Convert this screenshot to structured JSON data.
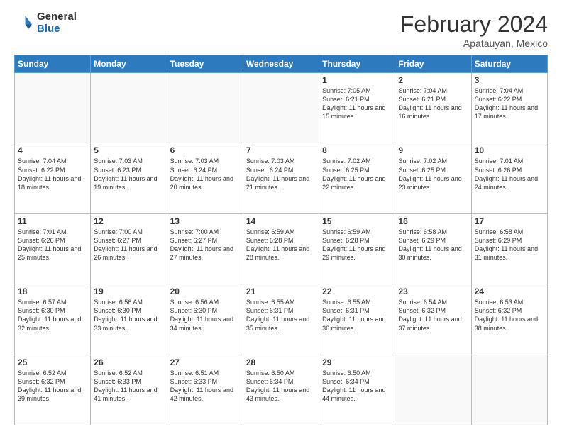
{
  "header": {
    "logo_general": "General",
    "logo_blue": "Blue",
    "month_title": "February 2024",
    "location": "Apatauyan, Mexico"
  },
  "weekdays": [
    "Sunday",
    "Monday",
    "Tuesday",
    "Wednesday",
    "Thursday",
    "Friday",
    "Saturday"
  ],
  "weeks": [
    [
      {
        "day": "",
        "info": ""
      },
      {
        "day": "",
        "info": ""
      },
      {
        "day": "",
        "info": ""
      },
      {
        "day": "",
        "info": ""
      },
      {
        "day": "1",
        "info": "Sunrise: 7:05 AM\nSunset: 6:21 PM\nDaylight: 11 hours and 15 minutes."
      },
      {
        "day": "2",
        "info": "Sunrise: 7:04 AM\nSunset: 6:21 PM\nDaylight: 11 hours and 16 minutes."
      },
      {
        "day": "3",
        "info": "Sunrise: 7:04 AM\nSunset: 6:22 PM\nDaylight: 11 hours and 17 minutes."
      }
    ],
    [
      {
        "day": "4",
        "info": "Sunrise: 7:04 AM\nSunset: 6:22 PM\nDaylight: 11 hours and 18 minutes."
      },
      {
        "day": "5",
        "info": "Sunrise: 7:03 AM\nSunset: 6:23 PM\nDaylight: 11 hours and 19 minutes."
      },
      {
        "day": "6",
        "info": "Sunrise: 7:03 AM\nSunset: 6:24 PM\nDaylight: 11 hours and 20 minutes."
      },
      {
        "day": "7",
        "info": "Sunrise: 7:03 AM\nSunset: 6:24 PM\nDaylight: 11 hours and 21 minutes."
      },
      {
        "day": "8",
        "info": "Sunrise: 7:02 AM\nSunset: 6:25 PM\nDaylight: 11 hours and 22 minutes."
      },
      {
        "day": "9",
        "info": "Sunrise: 7:02 AM\nSunset: 6:25 PM\nDaylight: 11 hours and 23 minutes."
      },
      {
        "day": "10",
        "info": "Sunrise: 7:01 AM\nSunset: 6:26 PM\nDaylight: 11 hours and 24 minutes."
      }
    ],
    [
      {
        "day": "11",
        "info": "Sunrise: 7:01 AM\nSunset: 6:26 PM\nDaylight: 11 hours and 25 minutes."
      },
      {
        "day": "12",
        "info": "Sunrise: 7:00 AM\nSunset: 6:27 PM\nDaylight: 11 hours and 26 minutes."
      },
      {
        "day": "13",
        "info": "Sunrise: 7:00 AM\nSunset: 6:27 PM\nDaylight: 11 hours and 27 minutes."
      },
      {
        "day": "14",
        "info": "Sunrise: 6:59 AM\nSunset: 6:28 PM\nDaylight: 11 hours and 28 minutes."
      },
      {
        "day": "15",
        "info": "Sunrise: 6:59 AM\nSunset: 6:28 PM\nDaylight: 11 hours and 29 minutes."
      },
      {
        "day": "16",
        "info": "Sunrise: 6:58 AM\nSunset: 6:29 PM\nDaylight: 11 hours and 30 minutes."
      },
      {
        "day": "17",
        "info": "Sunrise: 6:58 AM\nSunset: 6:29 PM\nDaylight: 11 hours and 31 minutes."
      }
    ],
    [
      {
        "day": "18",
        "info": "Sunrise: 6:57 AM\nSunset: 6:30 PM\nDaylight: 11 hours and 32 minutes."
      },
      {
        "day": "19",
        "info": "Sunrise: 6:56 AM\nSunset: 6:30 PM\nDaylight: 11 hours and 33 minutes."
      },
      {
        "day": "20",
        "info": "Sunrise: 6:56 AM\nSunset: 6:30 PM\nDaylight: 11 hours and 34 minutes."
      },
      {
        "day": "21",
        "info": "Sunrise: 6:55 AM\nSunset: 6:31 PM\nDaylight: 11 hours and 35 minutes."
      },
      {
        "day": "22",
        "info": "Sunrise: 6:55 AM\nSunset: 6:31 PM\nDaylight: 11 hours and 36 minutes."
      },
      {
        "day": "23",
        "info": "Sunrise: 6:54 AM\nSunset: 6:32 PM\nDaylight: 11 hours and 37 minutes."
      },
      {
        "day": "24",
        "info": "Sunrise: 6:53 AM\nSunset: 6:32 PM\nDaylight: 11 hours and 38 minutes."
      }
    ],
    [
      {
        "day": "25",
        "info": "Sunrise: 6:52 AM\nSunset: 6:32 PM\nDaylight: 11 hours and 39 minutes."
      },
      {
        "day": "26",
        "info": "Sunrise: 6:52 AM\nSunset: 6:33 PM\nDaylight: 11 hours and 41 minutes."
      },
      {
        "day": "27",
        "info": "Sunrise: 6:51 AM\nSunset: 6:33 PM\nDaylight: 11 hours and 42 minutes."
      },
      {
        "day": "28",
        "info": "Sunrise: 6:50 AM\nSunset: 6:34 PM\nDaylight: 11 hours and 43 minutes."
      },
      {
        "day": "29",
        "info": "Sunrise: 6:50 AM\nSunset: 6:34 PM\nDaylight: 11 hours and 44 minutes."
      },
      {
        "day": "",
        "info": ""
      },
      {
        "day": "",
        "info": ""
      }
    ]
  ]
}
